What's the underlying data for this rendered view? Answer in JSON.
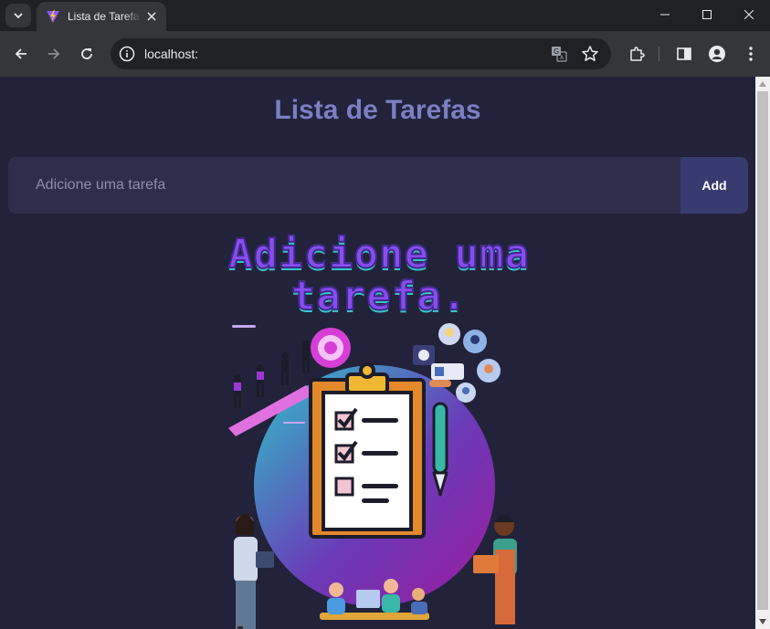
{
  "browser": {
    "tab_title": "Lista de Tarefas",
    "url": "localhost:"
  },
  "page": {
    "title": "Lista de Tarefas",
    "input_placeholder": "Adicione uma tarefa",
    "add_button_label": "Add",
    "empty_state_text": "Adicione uma tarefa."
  },
  "colors": {
    "page_background": "#22223a",
    "title": "#7b7fc4",
    "form_background": "#2e2e4a",
    "add_button": "#383b70",
    "empty_text": "#8a4cf0"
  }
}
